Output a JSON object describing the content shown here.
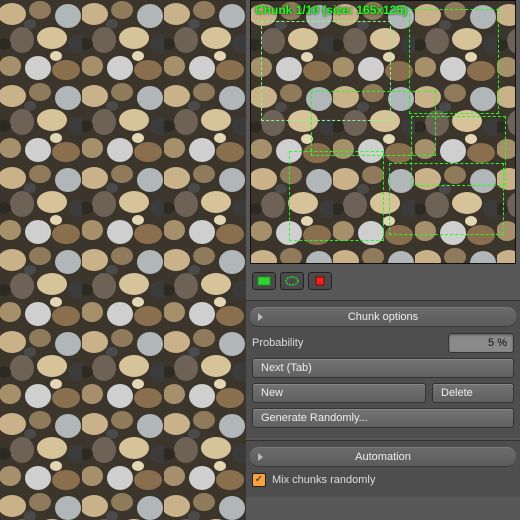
{
  "preview": {
    "overlay_label": "Chunk 1/10 (size: 165x125)"
  },
  "toolbar": {
    "icon_rect_name": "rect-select-icon",
    "icon_lasso_name": "lasso-select-icon",
    "icon_stop_name": "stop-record-icon"
  },
  "chunk_options": {
    "header": "Chunk options",
    "probability_label": "Probability",
    "probability_value": "5 %",
    "next_label": "Next (Tab)",
    "new_label": "New",
    "delete_label": "Delete",
    "generate_label": "Generate Randomly..."
  },
  "automation": {
    "header": "Automation",
    "mix_label": "Mix chunks randomly",
    "mix_checked": true
  }
}
